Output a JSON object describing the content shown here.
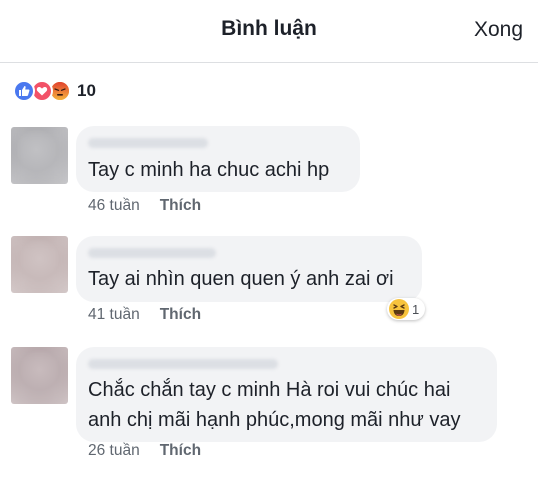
{
  "header": {
    "title": "Bình luận",
    "done_label": "Xong"
  },
  "reactions": {
    "icons": [
      "like-icon",
      "love-icon",
      "angry-icon"
    ],
    "count": "10"
  },
  "comments": [
    {
      "text_lines": [
        "Tay c minh ha chuc achi hp"
      ],
      "time": "46 tuần",
      "like_label": "Thích"
    },
    {
      "text_lines": [
        "Tay ai nhìn quen quen ý anh zai ơi"
      ],
      "time": "41 tuần",
      "like_label": "Thích",
      "reaction": {
        "icon": "haha-icon",
        "count": "1"
      }
    },
    {
      "text_lines": [
        "Chắc chắn tay c minh Hà roi vui chúc hai",
        "anh chị mãi hạnh phúc,mong mãi như vay"
      ],
      "time": "26 tuần",
      "like_label": "Thích"
    }
  ],
  "colors": {
    "like_blue": "#4a78ef",
    "love_red": "#f25268",
    "angry_orange": "#f4a53b",
    "bubble_bg": "#f2f3f5",
    "meta_gray": "#606770"
  }
}
